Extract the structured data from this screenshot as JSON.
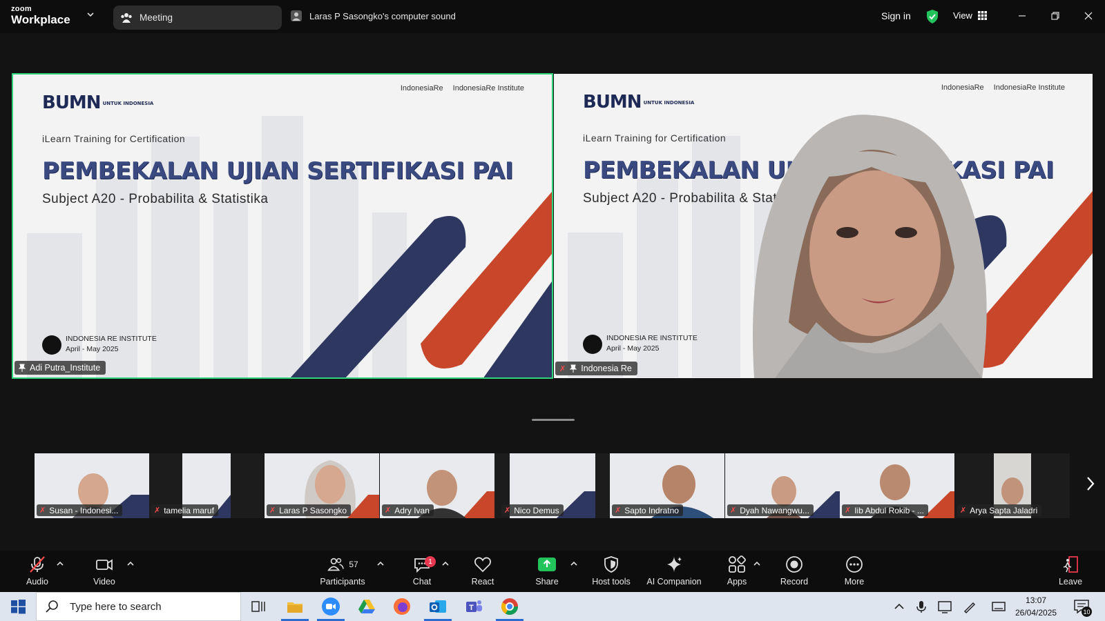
{
  "titlebar": {
    "logo_top": "zoom",
    "logo_bottom": "Workplace",
    "meeting_tab": "Meeting",
    "shared_sound": "Laras P Sasongko's computer sound",
    "sign_in": "Sign in",
    "view": "View"
  },
  "slide": {
    "brand": "BUMN",
    "brand_small": "UNTUK INDONESIA",
    "logo1": "IndonesiaRe",
    "logo2": "IndonesiaRe Institute",
    "kicker": "iLearn Training for Certification",
    "title": "PEMBEKALAN UJIAN SERTIFIKASI PAI",
    "subject": "Subject A20 - Probabilita & Statistika",
    "org": "INDONESIA RE INSTITUTE",
    "dates": "April - May 2025"
  },
  "stage": {
    "left_name": "Adi Putra_Institute",
    "right_name": "Indonesia Re"
  },
  "thumbnails": [
    {
      "name": "Susan - Indonesi..."
    },
    {
      "name": "tamelia maruf"
    },
    {
      "name": "Laras P Sasongko"
    },
    {
      "name": "Adry Ivan"
    },
    {
      "name": "Nico Demus"
    },
    {
      "name": "Sapto Indratno"
    },
    {
      "name": "Dyah Nawangwu..."
    },
    {
      "name": "Iib Abdul Rokib - ..."
    },
    {
      "name": "Arya Sapta Jaladri"
    }
  ],
  "toolbar": {
    "audio": "Audio",
    "video": "Video",
    "participants": "Participants",
    "participants_count": "57",
    "chat": "Chat",
    "chat_badge": "1",
    "react": "React",
    "share": "Share",
    "host_tools": "Host tools",
    "ai_companion": "AI Companion",
    "apps": "Apps",
    "record": "Record",
    "more": "More",
    "leave": "Leave"
  },
  "taskbar": {
    "search_placeholder": "Type here to search",
    "time": "13:07",
    "date": "26/04/2025",
    "notif_count": "10"
  },
  "colors": {
    "active_speaker_border": "#2ed37b",
    "share_green": "#23c35c",
    "slide_navy": "#2e3760",
    "slide_orange": "#c8472a",
    "badge_red": "#e8384f"
  }
}
